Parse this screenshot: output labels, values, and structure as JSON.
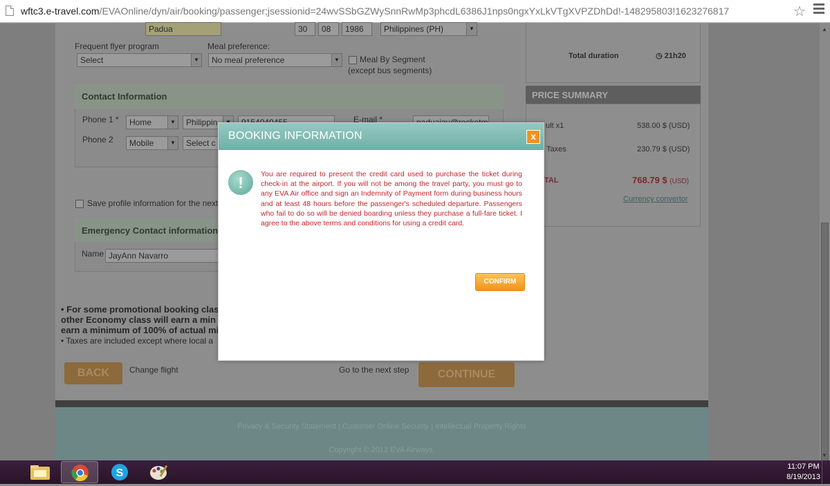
{
  "browser": {
    "url_host": "wftc3.e-travel.com",
    "url_path": "/EVAOnline/dyn/air/booking/passenger;jsessionid=24wvSSbGZWySnnRwMp3phcdL6386J1nps0ngxYxLkVTgXVPZDhDd!-148295803!1623276817"
  },
  "passenger": {
    "last_name": "Padua",
    "dob_day": "30",
    "dob_month": "08",
    "dob_year": "1986",
    "nationality": "Philippines (PH)",
    "frequent_flyer_label": "Frequent flyer program",
    "frequent_flyer_value": "Select",
    "meal_label": "Meal preference:",
    "meal_value": "No meal preference",
    "meal_by_segment_label": "Meal By Segment",
    "meal_by_segment_note": "(except bus segments)"
  },
  "contact": {
    "header": "Contact Information",
    "phone1_label": "Phone 1 *",
    "phone1_type": "Home",
    "phone1_country": "Philippin",
    "phone1_number": "9154040455",
    "phone2_label": "Phone 2",
    "phone2_type": "Mobile",
    "phone2_country": "Select c",
    "email_label": "E-mail *",
    "email_value": "paduajay@rocketm"
  },
  "profile": {
    "save_label": "Save profile information for the next"
  },
  "emergency": {
    "header": "Emergency Contact information (",
    "name_label": "Name",
    "name_value": "JayAnn Navarro"
  },
  "notes": {
    "line1": "• For some promotional booking clas",
    "line2": "other Economy class will earn a min",
    "line3": "earn a minimum of 100% of actual mil",
    "line4": "• Taxes are included except where local a"
  },
  "navigation": {
    "back_label": "BACK",
    "change_flight_label": "Change flight",
    "next_step_label": "Go to the next step",
    "continue_label": "CONTINUE"
  },
  "summary": {
    "total_duration_label": "Total duration",
    "total_duration_value": "21h20",
    "price_header": "PRICE SUMMARY",
    "adult_label": "ult x1",
    "adult_value": "538.00 $ (USD)",
    "taxes_label": "Taxes",
    "taxes_value": "230.79 $ (USD)",
    "total_label": "TAL",
    "total_value": "768.79 $",
    "total_currency": "(USD)",
    "currency_convertor": "Currency convertor"
  },
  "footer": {
    "links": "Privacy & Security Statement | Customer Online Security | Intellectual Property Rights",
    "copyright": "Copyright © 2012 EVA Airways."
  },
  "modal": {
    "title": "BOOKING INFORMATION",
    "close_glyph": "x",
    "icon_glyph": "!",
    "message": "You are required to present the credit card used to purchase the ticket during check-in at the airport. If you will not be among the travel party, you must go to any EVA Air office and sign an Indemnity of Payment form during business hours and at least 48 hours before the passenger's scheduled departure. Passengers who fail to do so will be denied boarding unless they purchase a full-fare ticket. I agree to the above terms and conditions for using a credit card.",
    "confirm_label": "CONFIRM"
  },
  "taskbar": {
    "time": "11:07 PM",
    "date": "8/19/2013"
  },
  "colors": {
    "modal_header": "#7fbcb3",
    "confirm": "#f5a12a",
    "message": "#c4272e",
    "taskbar": "#341b35"
  }
}
